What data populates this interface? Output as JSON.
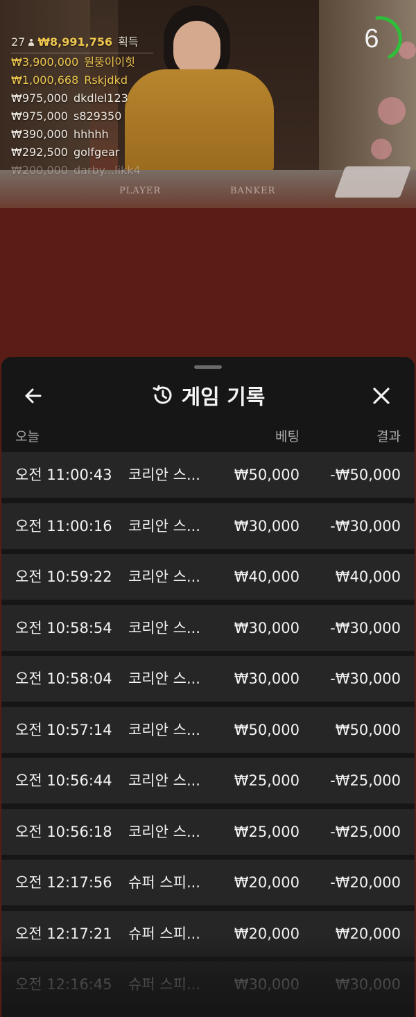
{
  "live": {
    "timer": "6",
    "table_labels": [
      "PLAYER",
      "BANKER"
    ],
    "winners": {
      "count": "27",
      "total": "₩8,991,756",
      "suffix": "획득",
      "list": [
        {
          "amount": "₩3,900,000",
          "name": "원뚱이이힛",
          "style": "gold"
        },
        {
          "amount": "₩1,000,668",
          "name": "Rskjdkd",
          "style": "gold"
        },
        {
          "amount": "₩975,000",
          "name": "dkdlel123",
          "style": "white"
        },
        {
          "amount": "₩975,000",
          "name": "s829350",
          "style": "white"
        },
        {
          "amount": "₩390,000",
          "name": "hhhhh",
          "style": "white"
        },
        {
          "amount": "₩292,500",
          "name": "golfgear",
          "style": "white"
        },
        {
          "amount": "₩200,000",
          "name": "darby...likk4",
          "style": "faded"
        }
      ]
    }
  },
  "panel": {
    "title": "게임 기록",
    "icons": {
      "back": "arrow-left-icon",
      "history": "history-icon",
      "close": "close-icon"
    },
    "columns": {
      "date": "오늘",
      "bet": "베팅",
      "result": "결과"
    },
    "rows": [
      {
        "time": "오전 11:00:43",
        "game": "코리안 스...",
        "bet": "₩50,000",
        "result": "-₩50,000"
      },
      {
        "time": "오전 11:00:16",
        "game": "코리안 스...",
        "bet": "₩30,000",
        "result": "-₩30,000"
      },
      {
        "time": "오전 10:59:22",
        "game": "코리안 스...",
        "bet": "₩40,000",
        "result": "₩40,000"
      },
      {
        "time": "오전 10:58:54",
        "game": "코리안 스...",
        "bet": "₩30,000",
        "result": "-₩30,000"
      },
      {
        "time": "오전 10:58:04",
        "game": "코리안 스...",
        "bet": "₩30,000",
        "result": "-₩30,000"
      },
      {
        "time": "오전 10:57:14",
        "game": "코리안 스...",
        "bet": "₩50,000",
        "result": "₩50,000"
      },
      {
        "time": "오전 10:56:44",
        "game": "코리안 스...",
        "bet": "₩25,000",
        "result": "-₩25,000"
      },
      {
        "time": "오전 10:56:18",
        "game": "코리안 스...",
        "bet": "₩25,000",
        "result": "-₩25,000"
      },
      {
        "time": "오전 12:17:56",
        "game": "슈퍼 스피...",
        "bet": "₩20,000",
        "result": "-₩20,000"
      },
      {
        "time": "오전 12:17:21",
        "game": "슈퍼 스피...",
        "bet": "₩20,000",
        "result": "₩20,000"
      },
      {
        "time": "오전 12:16:45",
        "game": "슈퍼 스피...",
        "bet": "₩30,000",
        "result": "₩30,000"
      }
    ]
  }
}
